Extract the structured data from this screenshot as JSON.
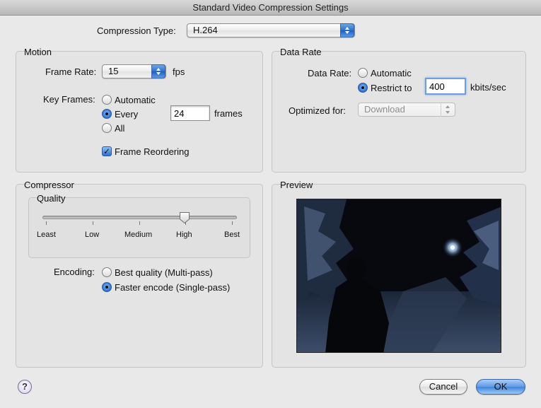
{
  "window": {
    "title": "Standard Video Compression Settings"
  },
  "compression_type": {
    "label": "Compression Type:",
    "value": "H.264"
  },
  "motion": {
    "title": "Motion",
    "frame_rate": {
      "label": "Frame Rate:",
      "value": "15",
      "unit": "fps"
    },
    "key_frames": {
      "label": "Key Frames:",
      "automatic": "Automatic",
      "every": "Every",
      "every_value": "24",
      "every_unit": "frames",
      "all": "All",
      "selected": "every"
    },
    "frame_reordering": {
      "label": "Frame Reordering",
      "checked": true
    }
  },
  "data_rate": {
    "title": "Data Rate",
    "label": "Data Rate:",
    "automatic": "Automatic",
    "restrict_to": "Restrict to",
    "restrict_value": "400",
    "unit": "kbits/sec",
    "selected": "restrict",
    "optimized_for": {
      "label": "Optimized for:",
      "value": "Download"
    }
  },
  "compressor": {
    "title": "Compressor",
    "quality": {
      "title": "Quality",
      "ticks": [
        "Least",
        "Low",
        "Medium",
        "High",
        "Best"
      ],
      "selected": "High"
    },
    "encoding": {
      "label": "Encoding:",
      "best_quality": "Best quality (Multi-pass)",
      "faster_encode": "Faster encode (Single-pass)",
      "selected": "faster"
    }
  },
  "preview": {
    "title": "Preview"
  },
  "buttons": {
    "help": "?",
    "cancel": "Cancel",
    "ok": "OK"
  },
  "colors": {
    "accent": "#2e6fd2",
    "focus_ring": "#6d9fe0"
  }
}
